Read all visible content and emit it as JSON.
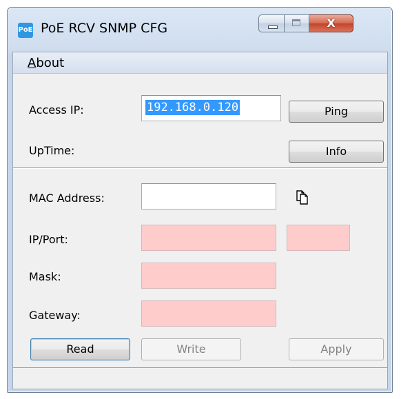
{
  "window": {
    "title": "PoE RCV SNMP CFG",
    "icon_text": "PoE",
    "close_glyph": "X"
  },
  "menu": {
    "about": "About",
    "about_rest": "bout",
    "about_accel": "A"
  },
  "access": {
    "ip_label": "Access IP:",
    "ip_value": "192.168.0.120",
    "uptime_label": "UpTime:",
    "ping_label": "Ping",
    "info_label": "Info"
  },
  "network": {
    "mac_label": "MAC Address:",
    "mac_value": "",
    "ip_port_label": "IP/Port:",
    "ip_value": "",
    "port_value": "",
    "mask_label": "Mask:",
    "mask_value": "",
    "gateway_label": "Gateway:",
    "gateway_value": ""
  },
  "actions": {
    "read_label": "Read",
    "write_label": "Write",
    "apply_label": "Apply"
  },
  "icons": {
    "app": "poe-app-icon",
    "copy": "copy-icon"
  },
  "colors": {
    "invalid_field": "#ffcccc",
    "selection": "#3399ff"
  }
}
